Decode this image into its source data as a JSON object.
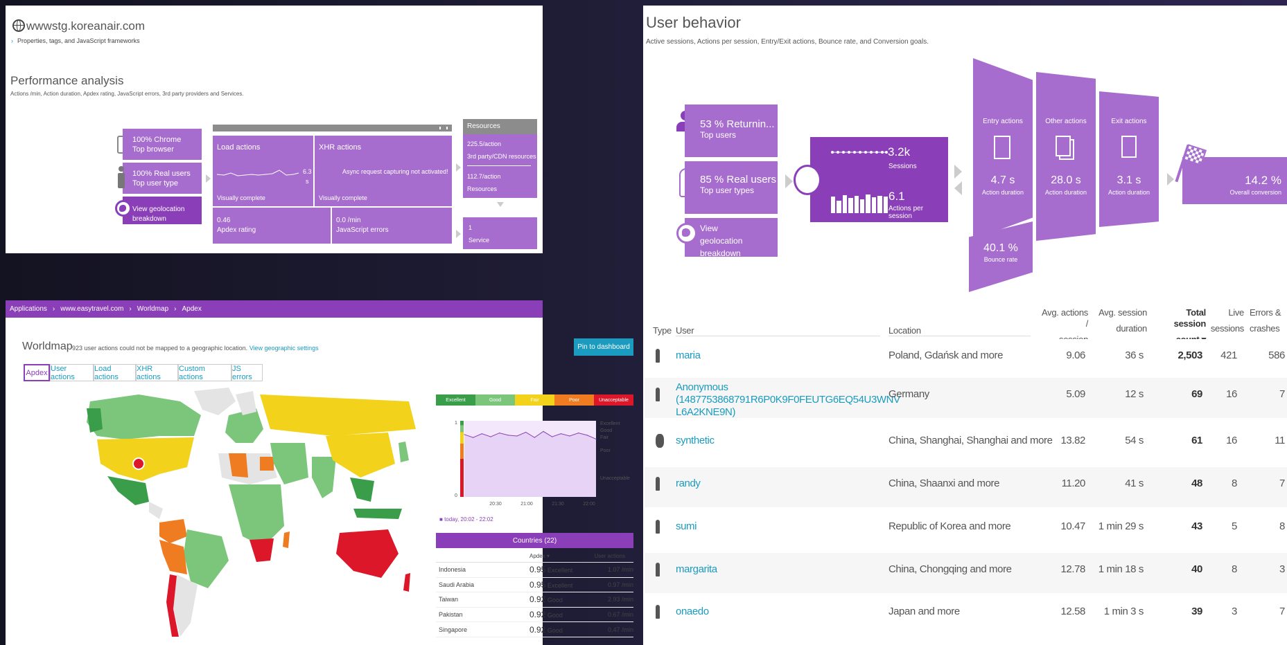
{
  "site": {
    "domain": "wwwstg.koreanair.com",
    "props_link": "Properties, tags, and JavaScript frameworks"
  },
  "perf": {
    "title": "Performance analysis",
    "subtitle": "Actions /min, Action duration, Apdex rating, JavaScript errors, 3rd party providers and Services.",
    "browser_pct": "100% Chrome",
    "browser_lbl": "Top browser",
    "users_pct": "100% Real users",
    "users_lbl": "Top user type",
    "geo": "View geolocation breakdown",
    "load_title": "Load actions",
    "load_value": "6.3",
    "load_unit": "s",
    "load_foot": "Visually complete",
    "xhr_title": "XHR actions",
    "xhr_note": "Async request capturing not activated!",
    "xhr_foot": "Visually complete",
    "apdex_value": "0.46",
    "apdex_lbl": "Apdex rating",
    "jserr_value": "0.0 /min",
    "jserr_lbl": "JavaScript errors",
    "res_header": "Resources",
    "res1_value": "225.5/action",
    "res1_lbl": "3rd party/CDN resources",
    "res2_value": "112.7/action",
    "res2_lbl": "Resources",
    "svc_value": "1",
    "svc_lbl": "Service"
  },
  "breadcrumb": [
    "Applications",
    "www.easytravel.com",
    "Worldmap",
    "Apdex"
  ],
  "worldmap": {
    "title": "Worldmap",
    "note": "923 user actions could not be mapped to a geographic location.",
    "settings_link": "View geographic settings",
    "pin": "Pin to dashboard",
    "tabs": [
      "Apdex",
      "User actions",
      "Load actions",
      "XHR actions",
      "Custom actions",
      "JS errors"
    ],
    "legend": [
      {
        "label": "Excellent",
        "color": "#3a9d4a"
      },
      {
        "label": "Good",
        "color": "#7cc67c"
      },
      {
        "label": "Fair",
        "color": "#f2d21b"
      },
      {
        "label": "Poor",
        "color": "#f07c22"
      },
      {
        "label": "Unacceptable",
        "color": "#dc172a"
      }
    ],
    "chart_y_top": "1",
    "chart_y_bottom": "0",
    "chart_zones": [
      "Excellent",
      "Good",
      "Fair",
      "Poor",
      "Unacceptable"
    ],
    "chart_x_ticks": [
      "20:30",
      "21:00",
      "21:30",
      "22:00"
    ],
    "timeframe": "today, 20:02 - 22:02",
    "countries_header": "Countries (22)",
    "col_apdex": "Apdex ▾",
    "col_actions": "User actions",
    "countries": [
      {
        "name": "Indonesia",
        "apdex": "0.95",
        "rating": "Excellent",
        "actions": "1.07 /min"
      },
      {
        "name": "Saudi Arabia",
        "apdex": "0.95",
        "rating": "Excellent",
        "actions": "0.97 /min"
      },
      {
        "name": "Taiwan",
        "apdex": "0.92",
        "rating": "Good",
        "actions": "2.93 /min"
      },
      {
        "name": "Pakistan",
        "apdex": "0.92",
        "rating": "Good",
        "actions": "0.67 /min"
      },
      {
        "name": "Singapore",
        "apdex": "0.92",
        "rating": "Good",
        "actions": "0.47 /min"
      }
    ]
  },
  "chart_data": {
    "type": "line",
    "x": [
      "20:02",
      "20:10",
      "20:18",
      "20:26",
      "20:34",
      "20:42",
      "20:50",
      "20:58",
      "21:06",
      "21:14",
      "21:22",
      "21:30",
      "21:38",
      "21:46",
      "21:54",
      "22:02"
    ],
    "values": [
      0.82,
      0.78,
      0.83,
      0.79,
      0.84,
      0.81,
      0.8,
      0.85,
      0.78,
      0.86,
      0.79,
      0.83,
      0.8,
      0.84,
      0.81,
      0.76
    ],
    "ylim": [
      0,
      1
    ],
    "xlabel": "",
    "ylabel": ""
  },
  "behavior": {
    "title": "User behavior",
    "subtitle": "Active sessions, Actions per session, Entry/Exit actions, Bounce rate, and Conversion goals.",
    "returning": "53 % Returnin...",
    "returning_lbl": "Top users",
    "realusers": "85 % Real users",
    "realusers_lbl": "Top user types",
    "geo": "View geolocation breakdown",
    "sessions": "3.2k",
    "sessions_lbl": "Sessions",
    "aps": "6.1",
    "aps_lbl": "Actions per session",
    "entry_title": "Entry actions",
    "entry_value": "4.7 s",
    "entry_lbl": "Action duration",
    "other_title": "Other actions",
    "other_value": "28.0 s",
    "other_lbl": "Action duration",
    "exit_title": "Exit actions",
    "exit_value": "3.1 s",
    "exit_lbl": "Action duration",
    "bounce_value": "40.1 %",
    "bounce_lbl": "Bounce rate",
    "conv_value": "14.2 %",
    "conv_lbl": "Overall conversion"
  },
  "sessions_table": {
    "headers": {
      "type": "Type",
      "user": "User",
      "location": "Location",
      "avg_actions_1": "Avg. actions /",
      "avg_actions_2": "session",
      "avg_dur_1": "Avg. session",
      "avg_dur_2": "duration",
      "total_1": "Total session",
      "total_2": "count ▾",
      "live_1": "Live",
      "live_2": "sessions",
      "err_1": "Errors &",
      "err_2": "crashes"
    },
    "rows": [
      {
        "user": "maria",
        "location": "Poland, Gdańsk and more",
        "avg_actions": "9.06",
        "avg_dur": "36 s",
        "total": "2,503",
        "live": "421",
        "errors": "586"
      },
      {
        "user": "Anonymous (1487753868791R6P0K9F0FEUTG6EQ54U3WNV L6A2KNE9N)",
        "location": "Germany",
        "avg_actions": "5.09",
        "avg_dur": "12 s",
        "total": "69",
        "live": "16",
        "errors": "7"
      },
      {
        "user": "synthetic",
        "location": "China, Shanghai, Shanghai and more",
        "avg_actions": "13.82",
        "avg_dur": "54 s",
        "total": "61",
        "live": "16",
        "errors": "11"
      },
      {
        "user": "randy",
        "location": "China, Shaanxi and more",
        "avg_actions": "11.20",
        "avg_dur": "41 s",
        "total": "48",
        "live": "8",
        "errors": "7"
      },
      {
        "user": "sumi",
        "location": "Republic of Korea and more",
        "avg_actions": "10.47",
        "avg_dur": "1 min 29 s",
        "total": "43",
        "live": "5",
        "errors": "8"
      },
      {
        "user": "margarita",
        "location": "China, Chongqing and more",
        "avg_actions": "12.78",
        "avg_dur": "1 min 18 s",
        "total": "40",
        "live": "8",
        "errors": "3"
      },
      {
        "user": "onaedo",
        "location": "Japan and more",
        "avg_actions": "12.58",
        "avg_dur": "1 min 3 s",
        "total": "39",
        "live": "3",
        "errors": "7"
      }
    ]
  }
}
